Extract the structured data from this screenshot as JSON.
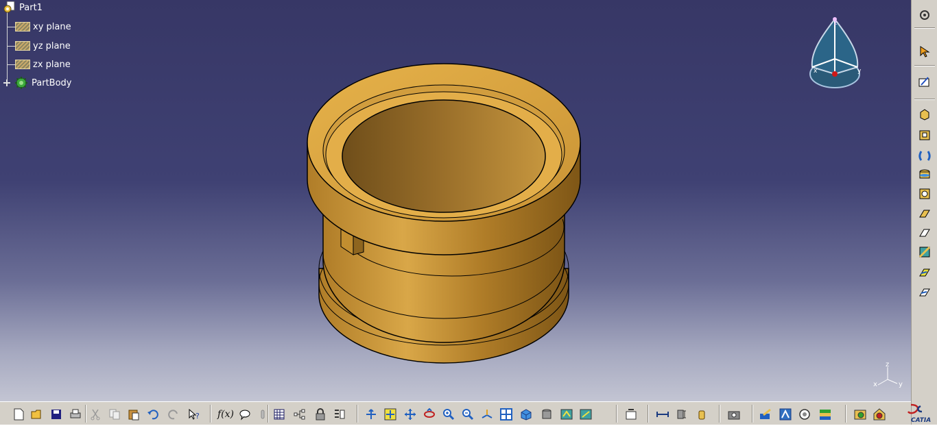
{
  "tree": {
    "root": {
      "label": "Part1",
      "icon": "part-icon"
    },
    "planes": [
      {
        "label": "xy plane",
        "icon": "plane-icon"
      },
      {
        "label": "yz plane",
        "icon": "plane-icon"
      },
      {
        "label": "zx plane",
        "icon": "plane-icon"
      }
    ],
    "body": {
      "label": "PartBody",
      "icon": "body-gear-icon"
    }
  },
  "compass": {
    "z": "z",
    "x": "x",
    "y": "y"
  },
  "axis_triad": {
    "z": "z",
    "x": "x",
    "y": "y"
  },
  "brand": {
    "logo_text": "CATIA"
  },
  "colors": {
    "viewport_top": "#373766",
    "viewport_bottom": "#c3c5d3",
    "part_gold": "#c89b3c",
    "toolbar_bg": "#d4d0c8"
  },
  "right_toolbar": [
    "settings-icon",
    "select-arrow-icon",
    "sketcher-icon",
    "pad-icon",
    "pocket-icon",
    "shaft-icon",
    "groove-icon",
    "hole-icon",
    "rib-icon",
    "slot-icon",
    "stiffener-icon",
    "multi-section-icon",
    "removed-multi-section-icon"
  ],
  "bottom_toolbar": [
    "new-file-icon",
    "open-file-icon",
    "save-icon",
    "print-icon",
    "cut-icon",
    "copy-icon",
    "paste-icon",
    "undo-icon",
    "redo-icon",
    "whats-this-icon",
    "formula-icon",
    "comment-icon",
    "knowledge-icon",
    "table-icon",
    "tree-expand-icon",
    "lock-icon",
    "fly-mode-icon",
    "fit-all-icon",
    "pan-icon",
    "rotate-icon",
    "zoom-in-icon",
    "zoom-out-icon",
    "normal-view-icon",
    "multi-view-icon",
    "iso-view-icon",
    "shading-icon",
    "hide-show-icon",
    "swap-space-icon",
    "update-icon",
    "measure-between-icon",
    "measure-item-icon",
    "measure-inertia-icon",
    "capture-icon",
    "apply-material-icon",
    "sketch-analysis-icon",
    "catalog-icon",
    "color-map-icon",
    "render-icon",
    "scene-icon"
  ]
}
